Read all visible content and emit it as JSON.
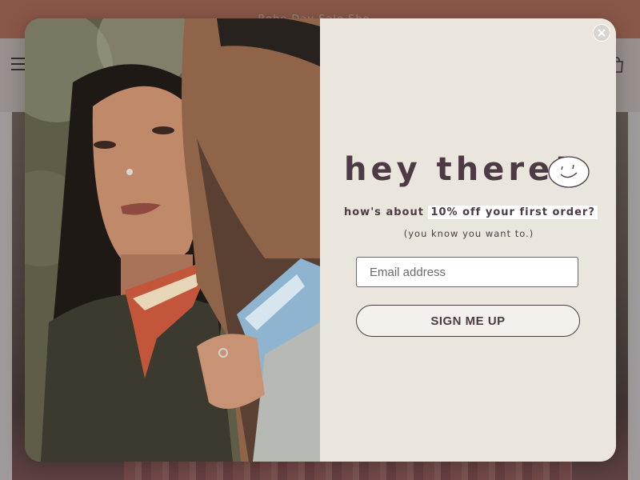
{
  "announcement": {
    "text": "Boho Day Sale Sho..."
  },
  "header": {
    "menu_icon": "hamburger-icon",
    "cart_icon": "cart-icon"
  },
  "modal": {
    "photo_alt": "Couple wearing bandanas outdoors",
    "close_icon": "close-icon",
    "headline": "hey there!",
    "offer_prefix": "how's about ",
    "offer_highlight": "10% off your first order?",
    "subtext": "(you know you want to.)",
    "email_placeholder": "Email address",
    "email_value": "",
    "signup_label": "SIGN ME UP"
  },
  "colors": {
    "announcement_bg": "#d9876a",
    "modal_bg": "#ebe6dd",
    "text_primary": "#4d3a45",
    "button_bg": "#f4f0eb"
  }
}
